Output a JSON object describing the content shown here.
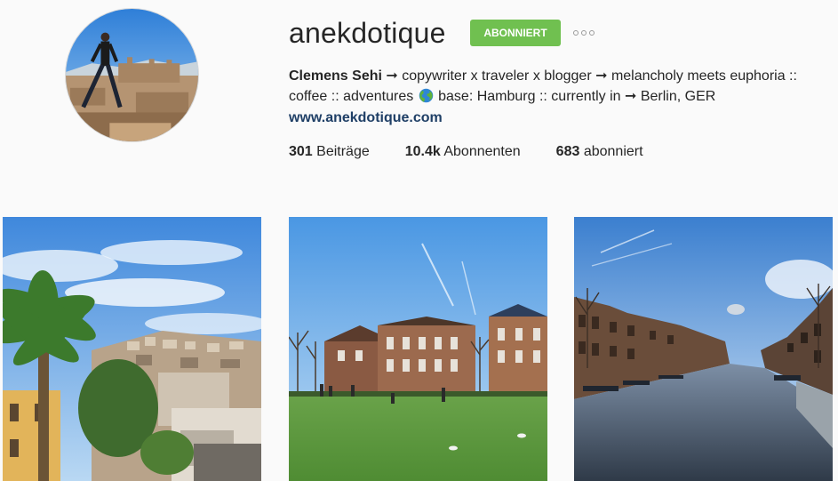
{
  "profile": {
    "username": "anekdotique",
    "follow_label": "ABONNIERT",
    "bio": {
      "name": "Clemens Sehi",
      "line1_rest": " ➞ copywriter x traveler x blogger ➞ melancholy meets euphoria ::",
      "line2_before_globe": "coffee :: adventures ",
      "line2_after_globe": " base: Hamburg :: currently in ➞ Berlin, GER"
    },
    "website": "www.anekdotique.com",
    "stats": [
      {
        "count": "301",
        "label": " Beiträge"
      },
      {
        "count": "10.4k",
        "label": " Abonnenten"
      },
      {
        "count": "683",
        "label": " abonniert"
      }
    ]
  },
  "icons": {
    "more": "more-options-icon",
    "globe": "globe-emoji-icon"
  },
  "colors": {
    "follow_button": "#70c050",
    "link": "#1f3f66",
    "background": "#fafafa"
  },
  "posts": [
    {
      "subject": "palm-tree-hillside-city"
    },
    {
      "subject": "park-with-brick-buildings"
    },
    {
      "subject": "canal-with-houseboats"
    }
  ]
}
